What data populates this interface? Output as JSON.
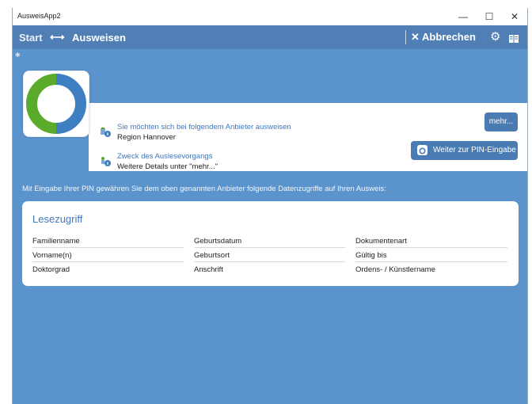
{
  "window": {
    "title": "AusweisApp2",
    "controls": {
      "minimize": "—",
      "maximize": "☐",
      "close": "✕"
    }
  },
  "navbar": {
    "start_label": "Start",
    "arrow": "⟷",
    "current_label": "Ausweisen",
    "cancel_label": "✕ Abbrechen",
    "gear": "⚙"
  },
  "provider": {
    "info_title": "Sie möchten sich bei folgendem Anbieter ausweisen",
    "info_value": "Region Hannover",
    "purpose_title": "Zweck des Auslesevorgangs",
    "purpose_value": "Weitere Details unter \"mehr...\"",
    "more_button": "mehr...",
    "pin_button": "Weiter zur PIN-Eingabe"
  },
  "notice": "Mit Eingabe Ihrer PIN gewähren Sie dem oben genannten Anbieter folgende Datenzugriffe auf Ihren Ausweis:",
  "read_access": {
    "title": "Lesezugriff",
    "fields": [
      "Familienname",
      "Geburtsdatum",
      "Dokumentenart",
      "Vorname(n)",
      "Geburtsort",
      "Gültig bis",
      "Doktorgrad",
      "Anschrift",
      "Ordens- / Künstlername"
    ]
  },
  "colors": {
    "background": "#5b93cc",
    "navbar": "#4f7fb4",
    "accent": "#3f78bd",
    "button": "#4a7cb3",
    "logo_green": "#5aaa2c",
    "logo_blue": "#3e7fc1"
  }
}
